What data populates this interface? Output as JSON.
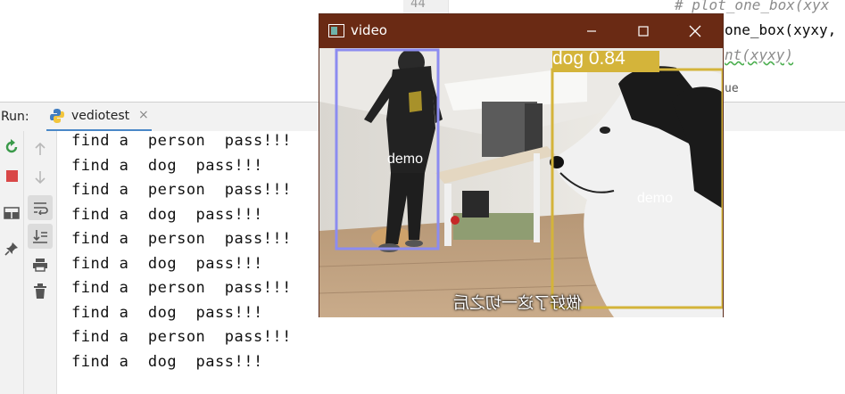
{
  "editor": {
    "line_number": "44",
    "code_line_1": "# plot_one_box(xyx",
    "code_line_2": "one_box(xyxy,",
    "code_line_3": "nt(xyxy)",
    "code_line_4": "ue"
  },
  "run_panel": {
    "label": "Run:",
    "tab_name": "vediotest",
    "tab_close": "×",
    "icons": [
      "rerun-icon",
      "stop-icon",
      "layout-icon",
      "pin-icon",
      "up-arrow-icon",
      "down-arrow-icon",
      "soft-wrap-icon",
      "scroll-to-end-icon",
      "print-icon",
      "trash-icon"
    ],
    "output_lines": [
      "find a  person  pass!!!",
      "find a  dog  pass!!!",
      "find a  person  pass!!!",
      "find a  dog  pass!!!",
      "find a  person  pass!!!",
      "find a  dog  pass!!!",
      "find a  person  pass!!!",
      "find a  dog  pass!!!",
      "find a  person  pass!!!",
      "find a  dog  pass!!!"
    ]
  },
  "video_window": {
    "title": "video",
    "title_bar_color": "#6a2a14",
    "buttons": {
      "minimize": "—",
      "maximize": "☐",
      "close": "✕"
    },
    "detections": [
      {
        "label": "dog 0.84",
        "tag": "demo",
        "color": "#d4b43a"
      },
      {
        "label": "",
        "tag": "demo",
        "color": "#8c8cf0"
      }
    ],
    "subtitle": "做好了这一切之后"
  }
}
